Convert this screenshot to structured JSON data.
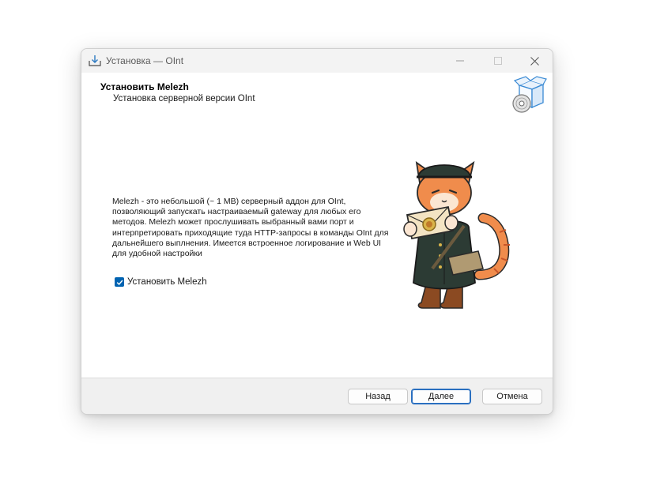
{
  "window": {
    "title": "Установка — OInt"
  },
  "header": {
    "title": "Установить Melezh",
    "subtitle": "Установка серверной версии OInt",
    "icon": "box-disc-icon"
  },
  "main": {
    "description": "Melezh - это небольшой (~ 1 MB) серверный аддон для OInt, позволяющий запускать настраиваемый gateway для любых его методов. Melezh может прослушивать выбранный вами порт и интерпретировать приходящие туда HTTP-запросы в команды OInt для дальнейшего выплнения. Имеется встроенное логирование и Web UI для удобной настройки",
    "checkbox": {
      "label": "Установить Melezh",
      "checked": true
    },
    "illustration": "cat-mascot-with-envelope"
  },
  "footer": {
    "back_label": "Назад",
    "next_label": "Далее",
    "cancel_label": "Отмена"
  },
  "colors": {
    "accent": "#0063b1",
    "window_bg": "#f3f3f3",
    "content_bg": "#ffffff"
  }
}
